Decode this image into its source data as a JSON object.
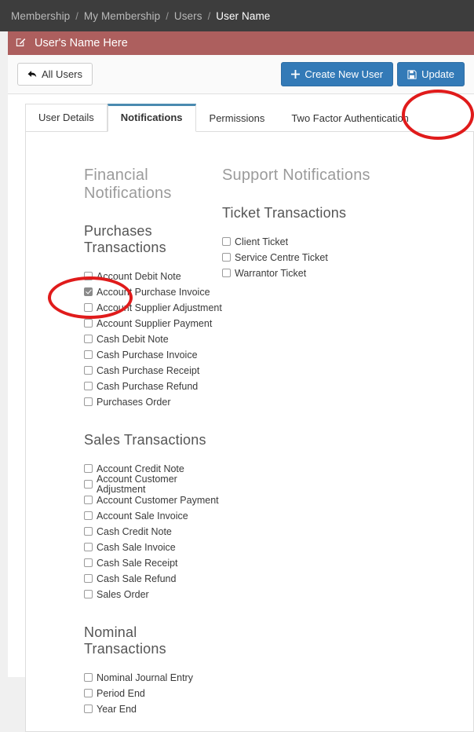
{
  "breadcrumb": {
    "separator": "/",
    "items": [
      {
        "label": "Membership",
        "active": false
      },
      {
        "label": "My Membership",
        "active": false
      },
      {
        "label": "Users",
        "active": false
      },
      {
        "label": "User Name",
        "active": true
      }
    ]
  },
  "panel": {
    "header_icon": "edit-square-icon",
    "header_title": "User's Name Here",
    "header_color": "#ad5f5e"
  },
  "toolbar": {
    "all_users_label": "All Users",
    "all_users_icon": "back-arrow-icon",
    "create_new_user_label": "Create New User",
    "create_new_user_icon": "plus-icon",
    "update_label": "Update",
    "update_icon": "floppy-save-icon",
    "primary_color": "#337ab7"
  },
  "tabs": [
    {
      "label": "User Details",
      "active": false
    },
    {
      "label": "Notifications",
      "active": true
    },
    {
      "label": "Permissions",
      "active": false
    },
    {
      "label": "Two Factor Authentication",
      "active": false
    }
  ],
  "left_column": {
    "group_title": "Financial Notifications",
    "sections": [
      {
        "title": "Purchases Transactions",
        "items": [
          {
            "label": "Account Debit Note",
            "checked": false
          },
          {
            "label": "Account Purchase Invoice",
            "checked": true
          },
          {
            "label": "Account Supplier Adjustment",
            "checked": false
          },
          {
            "label": "Account Supplier Payment",
            "checked": false
          },
          {
            "label": "Cash Debit Note",
            "checked": false
          },
          {
            "label": "Cash Purchase Invoice",
            "checked": false
          },
          {
            "label": "Cash Purchase Receipt",
            "checked": false
          },
          {
            "label": "Cash Purchase Refund",
            "checked": false
          },
          {
            "label": "Purchases Order",
            "checked": false
          }
        ]
      },
      {
        "title": "Sales Transactions",
        "items": [
          {
            "label": "Account Credit Note",
            "checked": false
          },
          {
            "label": "Account Customer Adjustment",
            "checked": false
          },
          {
            "label": "Account Customer Payment",
            "checked": false
          },
          {
            "label": "Account Sale Invoice",
            "checked": false
          },
          {
            "label": "Cash Credit Note",
            "checked": false
          },
          {
            "label": "Cash Sale Invoice",
            "checked": false
          },
          {
            "label": "Cash Sale Receipt",
            "checked": false
          },
          {
            "label": "Cash Sale Refund",
            "checked": false
          },
          {
            "label": "Sales Order",
            "checked": false
          }
        ]
      },
      {
        "title": "Nominal Transactions",
        "items": [
          {
            "label": "Nominal Journal Entry",
            "checked": false
          },
          {
            "label": "Period End",
            "checked": false
          },
          {
            "label": "Year End",
            "checked": false
          }
        ]
      }
    ]
  },
  "right_column": {
    "group_title": "Support Notifications",
    "sections": [
      {
        "title": "Ticket Transactions",
        "items": [
          {
            "label": "Client Ticket",
            "checked": false
          },
          {
            "label": "Service Centre Ticket",
            "checked": false
          },
          {
            "label": "Warrantor Ticket",
            "checked": false
          }
        ]
      }
    ]
  },
  "annotations": {
    "color": "#e01b1b",
    "shapes": [
      {
        "name": "update-button-highlight",
        "target": "Update"
      },
      {
        "name": "account-purchase-invoice-checkbox-highlight",
        "target": "Account Purchase Invoice"
      }
    ]
  }
}
